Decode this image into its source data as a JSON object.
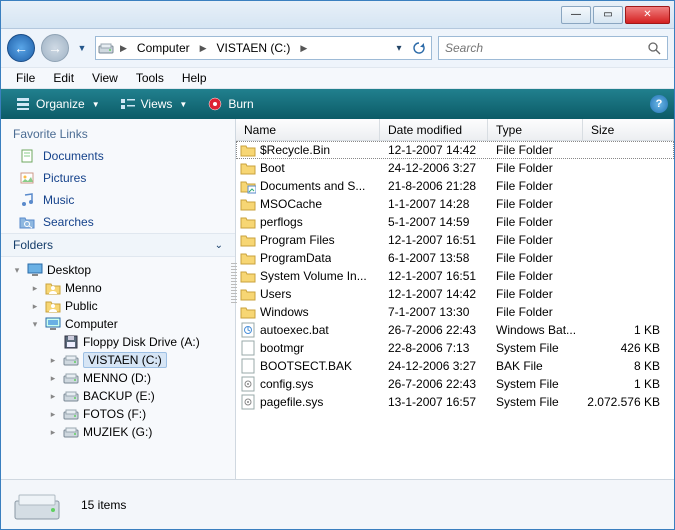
{
  "titlebar": {
    "min": "—",
    "max": "▭",
    "close": "✕"
  },
  "nav": {
    "back": "←",
    "forward": "→"
  },
  "breadcrumb": {
    "root": "Computer",
    "drive": "VISTAEN (C:)"
  },
  "search": {
    "placeholder": "Search"
  },
  "menu": {
    "file": "File",
    "edit": "Edit",
    "view": "View",
    "tools": "Tools",
    "help": "Help"
  },
  "toolbar": {
    "organize": "Organize",
    "views": "Views",
    "burn": "Burn"
  },
  "side": {
    "favorites_header": "Favorite Links",
    "favorites": [
      {
        "label": "Documents",
        "icon": "docs"
      },
      {
        "label": "Pictures",
        "icon": "pics"
      },
      {
        "label": "Music",
        "icon": "music"
      },
      {
        "label": "Searches",
        "icon": "search"
      }
    ],
    "folders_header": "Folders",
    "tree": [
      {
        "label": "Desktop",
        "depth": 0,
        "icon": "desktop",
        "exp": "open"
      },
      {
        "label": "Menno",
        "depth": 1,
        "icon": "user",
        "exp": "closed"
      },
      {
        "label": "Public",
        "depth": 1,
        "icon": "user",
        "exp": "closed"
      },
      {
        "label": "Computer",
        "depth": 1,
        "icon": "computer",
        "exp": "open"
      },
      {
        "label": "Floppy Disk Drive (A:)",
        "depth": 2,
        "icon": "floppy",
        "exp": "none"
      },
      {
        "label": "VISTAEN (C:)",
        "depth": 2,
        "icon": "hdd",
        "exp": "closed",
        "selected": true
      },
      {
        "label": "MENNO (D:)",
        "depth": 2,
        "icon": "hdd",
        "exp": "closed"
      },
      {
        "label": "BACKUP (E:)",
        "depth": 2,
        "icon": "hdd",
        "exp": "closed"
      },
      {
        "label": "FOTOS (F:)",
        "depth": 2,
        "icon": "hdd",
        "exp": "closed"
      },
      {
        "label": "MUZIEK (G:)",
        "depth": 2,
        "icon": "hdd",
        "exp": "closed"
      }
    ]
  },
  "columns": {
    "name": "Name",
    "date": "Date modified",
    "type": "Type",
    "size": "Size"
  },
  "files": [
    {
      "name": "$Recycle.Bin",
      "date": "12-1-2007 14:42",
      "type": "File Folder",
      "size": "",
      "icon": "folder",
      "selected": true
    },
    {
      "name": "Boot",
      "date": "24-12-2006 3:27",
      "type": "File Folder",
      "size": "",
      "icon": "folder"
    },
    {
      "name": "Documents and S...",
      "date": "21-8-2006 21:28",
      "type": "File Folder",
      "size": "",
      "icon": "folder-short"
    },
    {
      "name": "MSOCache",
      "date": "1-1-2007 14:28",
      "type": "File Folder",
      "size": "",
      "icon": "folder"
    },
    {
      "name": "perflogs",
      "date": "5-1-2007 14:59",
      "type": "File Folder",
      "size": "",
      "icon": "folder"
    },
    {
      "name": "Program Files",
      "date": "12-1-2007 16:51",
      "type": "File Folder",
      "size": "",
      "icon": "folder"
    },
    {
      "name": "ProgramData",
      "date": "6-1-2007 13:58",
      "type": "File Folder",
      "size": "",
      "icon": "folder"
    },
    {
      "name": "System Volume In...",
      "date": "12-1-2007 16:51",
      "type": "File Folder",
      "size": "",
      "icon": "folder"
    },
    {
      "name": "Users",
      "date": "12-1-2007 14:42",
      "type": "File Folder",
      "size": "",
      "icon": "folder"
    },
    {
      "name": "Windows",
      "date": "7-1-2007 13:30",
      "type": "File Folder",
      "size": "",
      "icon": "folder"
    },
    {
      "name": "autoexec.bat",
      "date": "26-7-2006 22:43",
      "type": "Windows Bat...",
      "size": "1 KB",
      "icon": "bat"
    },
    {
      "name": "bootmgr",
      "date": "22-8-2006 7:13",
      "type": "System File",
      "size": "426 KB",
      "icon": "sys"
    },
    {
      "name": "BOOTSECT.BAK",
      "date": "24-12-2006 3:27",
      "type": "BAK File",
      "size": "8 KB",
      "icon": "sys"
    },
    {
      "name": "config.sys",
      "date": "26-7-2006 22:43",
      "type": "System File",
      "size": "1 KB",
      "icon": "cfg"
    },
    {
      "name": "pagefile.sys",
      "date": "13-1-2007 16:57",
      "type": "System File",
      "size": "2.072.576 KB",
      "icon": "cfg"
    }
  ],
  "status": {
    "count": "15 items"
  }
}
